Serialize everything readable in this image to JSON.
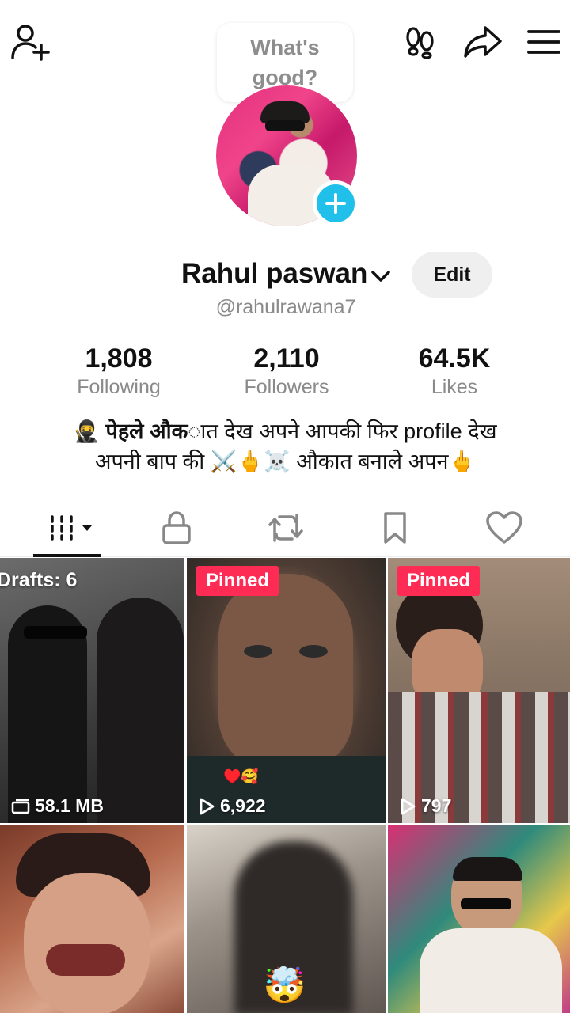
{
  "header": {
    "status_prompt": "What's good?",
    "icons": [
      "add-friend-icon",
      "footprints-icon",
      "share-icon",
      "menu-icon"
    ]
  },
  "profile": {
    "name": "Rahul paswan",
    "handle": "@rahulrawana7",
    "edit_label": "Edit",
    "stats": [
      {
        "value": "1,808",
        "label": "Following"
      },
      {
        "value": "2,110",
        "label": "Followers"
      },
      {
        "value": "64.5K",
        "label": "Likes"
      }
    ],
    "bio_bold": "पेहले औक",
    "bio_line1_rest": "ात देख अपने आपकी फिर profile देख",
    "bio_line2": "अपनी बाप की ⚔️🖕☠️ औकात बनाले अपन🖕",
    "bio_emoji": "🥷"
  },
  "tabs": [
    "videos-grid-tab",
    "private-tab",
    "reposts-tab",
    "favorites-tab",
    "liked-tab"
  ],
  "grid": [
    {
      "badge": "Drafts: 6",
      "footer": "58.1 MB",
      "footer_icon": "drafts-icon"
    },
    {
      "badge": "Pinned",
      "footer": "6,922",
      "footer_icon": "play-icon",
      "emoji": "♥️🥰"
    },
    {
      "badge": "Pinned",
      "footer": "797",
      "footer_icon": "play-icon"
    },
    {
      "badge": "",
      "footer": ""
    },
    {
      "badge": "",
      "footer": "",
      "emoji": "🤯"
    },
    {
      "badge": "",
      "footer": ""
    }
  ],
  "colors": {
    "accent": "#fe2c55",
    "plus_badge": "#21c0ea",
    "muted_text": "#8a8a8a"
  }
}
